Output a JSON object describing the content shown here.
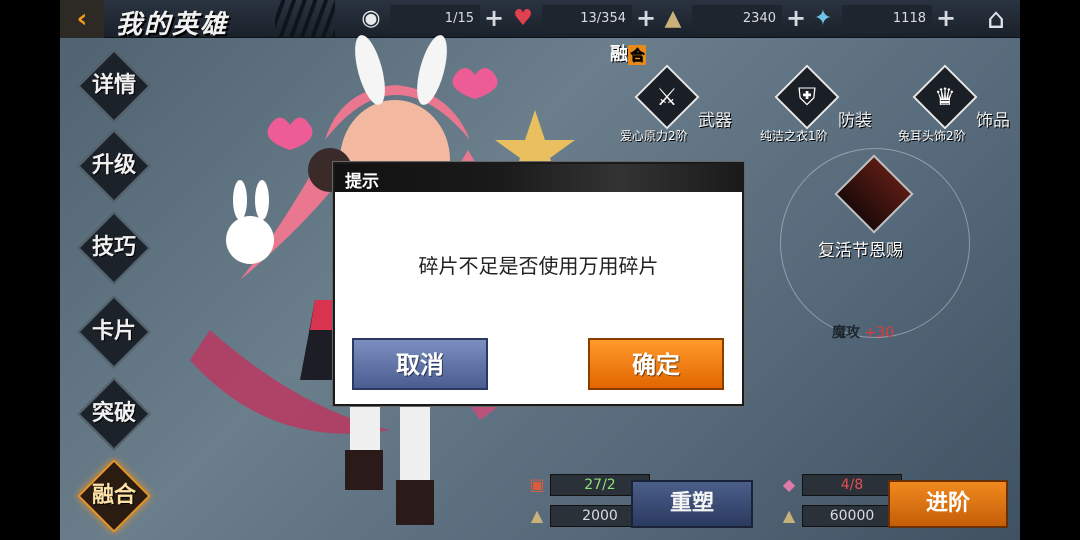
{
  "header": {
    "back_icon": "back-arrow-icon",
    "title": "我的英雄",
    "resources": [
      {
        "icon": "eye-icon",
        "value": "1/15"
      },
      {
        "icon": "heart-icon",
        "value": "13/354"
      },
      {
        "icon": "coin-icon",
        "value": "2340"
      },
      {
        "icon": "crystal-icon",
        "value": "1118"
      }
    ],
    "home_icon": "home-icon"
  },
  "menu": {
    "items": [
      {
        "label": "详情"
      },
      {
        "label": "升级"
      },
      {
        "label": "技巧"
      },
      {
        "label": "卡片"
      },
      {
        "label": "突破"
      },
      {
        "label": "融合",
        "active": true
      }
    ]
  },
  "fusion": {
    "tag_main": "融",
    "tag_box": "合",
    "equipment": [
      {
        "type": "武器",
        "name": "爱心原力2阶",
        "icon": "weapon-icon"
      },
      {
        "type": "防装",
        "name": "纯洁之衣1阶",
        "icon": "armor-icon"
      },
      {
        "type": "饰品",
        "name": "兔耳头饰2阶",
        "icon": "accessory-icon"
      }
    ],
    "skill_name": "复活节恩赐",
    "stat_key": "魔攻",
    "stat_val": "+30"
  },
  "bottom": {
    "left_shard": "27/2",
    "left_cost": "2000",
    "rebuild_label": "重塑",
    "right_shard": "4/8",
    "right_cost": "60000",
    "advance_label": "进阶"
  },
  "dialog": {
    "title": "提示",
    "message": "碎片不足是否使用万用碎片",
    "cancel_label": "取消",
    "confirm_label": "确定"
  },
  "colors": {
    "accent_orange": "#f08a1e",
    "button_blue": "#4b5f8a",
    "stat_red": "#e03a3a"
  }
}
